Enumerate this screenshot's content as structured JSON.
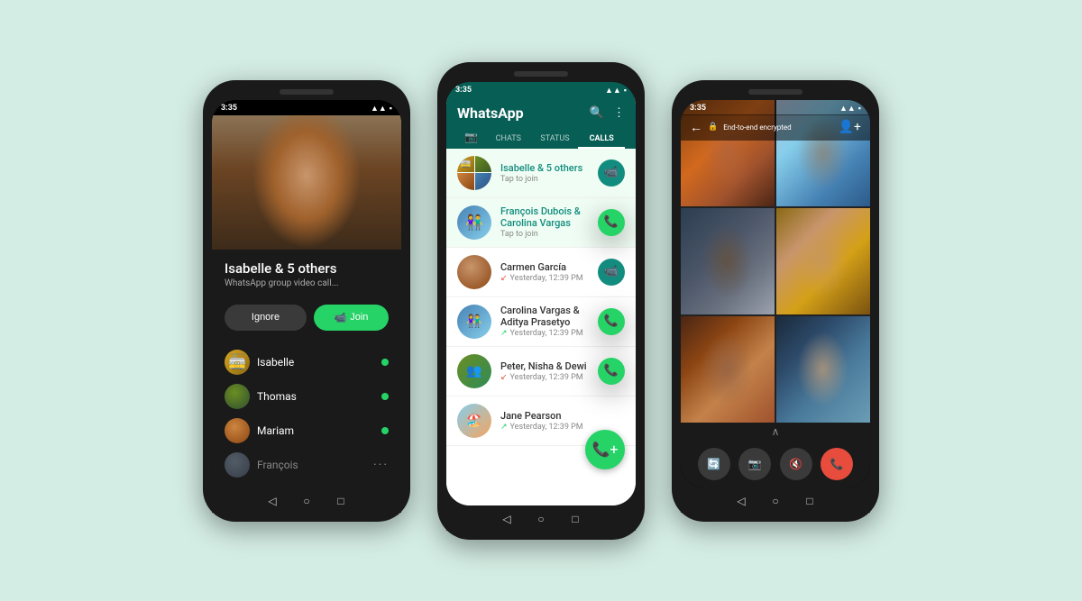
{
  "background": "#d4ede4",
  "phone1": {
    "status_time": "3:35",
    "caller_name": "Isabelle & 5 others",
    "caller_subtitle": "WhatsApp group video call...",
    "btn_ignore": "Ignore",
    "btn_join": "Join",
    "participants": [
      {
        "name": "Isabelle",
        "avatar_type": "tram",
        "online": true
      },
      {
        "name": "Thomas",
        "avatar_type": "thomas",
        "online": true
      },
      {
        "name": "Mariam",
        "avatar_type": "mariam",
        "online": true
      },
      {
        "name": "François",
        "avatar_type": "francois",
        "online": false,
        "muted": true
      }
    ],
    "nav": {
      "back": "◁",
      "home": "○",
      "recent": "□"
    }
  },
  "phone2": {
    "status_time": "3:35",
    "app_title": "WhatsApp",
    "tabs": [
      "📷",
      "CHATS",
      "STATUS",
      "CALLS"
    ],
    "active_tab": "CALLS",
    "calls": [
      {
        "name": "Isabelle & 5 others",
        "subtitle": "Tap to join",
        "type": "video",
        "highlighted": true,
        "avatar_type": "group"
      },
      {
        "name": "François Dubois & Carolina Vargas",
        "subtitle": "Tap to join",
        "type": "phone",
        "highlighted": true,
        "avatar_type": "group2"
      },
      {
        "name": "Carmen García",
        "time": "Yesterday, 12:39 PM",
        "type": "video",
        "highlighted": false,
        "direction": "missed",
        "avatar_type": "woman"
      },
      {
        "name": "Carolina Vargas & Aditya Prasetyo",
        "time": "Yesterday, 12:39 PM",
        "type": "phone",
        "highlighted": false,
        "direction": "out",
        "avatar_type": "couple"
      },
      {
        "name": "Peter, Nisha & Dewi",
        "time": "Yesterday, 12:39 PM",
        "type": "phone",
        "highlighted": false,
        "direction": "missed",
        "avatar_type": "group3"
      },
      {
        "name": "Jane Pearson",
        "time": "Yesterday, 12:39 PM",
        "type": "phone",
        "highlighted": false,
        "direction": "out",
        "avatar_type": "beach"
      }
    ],
    "nav": {
      "back": "◁",
      "home": "○",
      "recent": "□"
    }
  },
  "phone3": {
    "status_time": "3:35",
    "encrypted_text": "End-to-end encrypted",
    "nav": {
      "back": "◁",
      "home": "○",
      "recent": "□"
    },
    "controls": {
      "camera": "🔄",
      "video_off": "📷",
      "mute": "🔇",
      "end": "📞"
    }
  }
}
